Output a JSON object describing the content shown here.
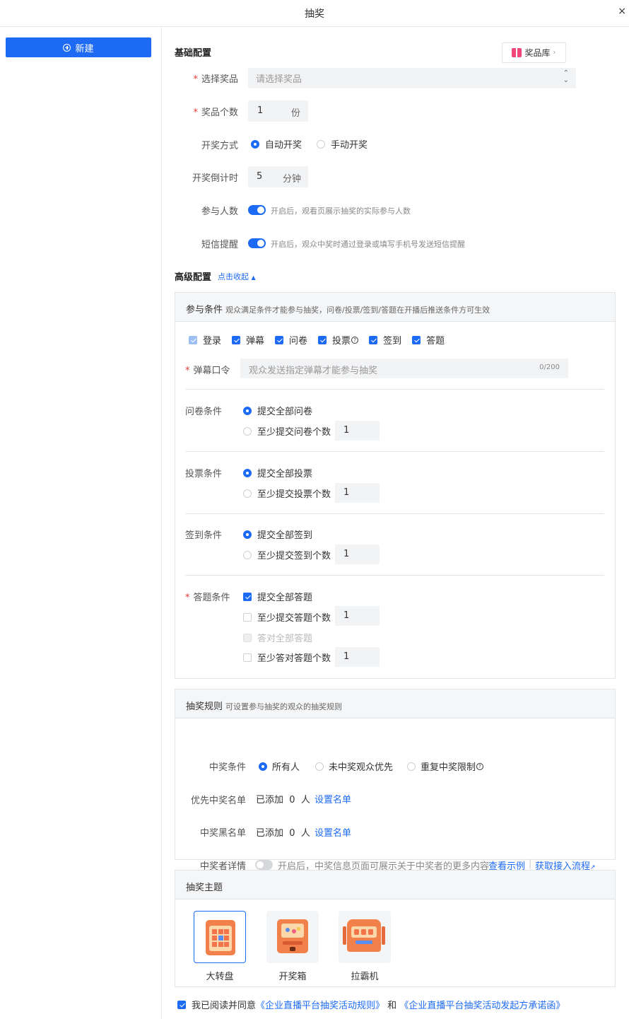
{
  "header": {
    "title": "抽奖",
    "close_icon": "×"
  },
  "sidebar": {
    "new_button": "新建"
  },
  "basic": {
    "title": "基础配置",
    "prize_lib": "奖品库",
    "prize_label": "选择奖品",
    "prize_placeholder": "请选择奖品",
    "count_label": "奖品个数",
    "count_value": "1",
    "count_unit": "份",
    "mode_label": "开奖方式",
    "mode_auto": "自动开奖",
    "mode_manual": "手动开奖",
    "countdown_label": "开奖倒计时",
    "countdown_value": "5",
    "countdown_unit": "分钟",
    "participants_label": "参与人数",
    "participants_hint": "开启后，观看页展示抽奖的实际参与人数",
    "sms_label": "短信提醒",
    "sms_hint": "开启后，观众中奖时通过登录或填写手机号发送短信提醒"
  },
  "advanced": {
    "title": "高级配置",
    "collapse": "点击收起"
  },
  "conditions": {
    "title": "参与条件",
    "desc": "观众满足条件才能参与抽奖，问卷/投票/签到/答题在开播后推送条件方可生效",
    "checks": [
      "登录",
      "弹幕",
      "问卷",
      "投票",
      "签到",
      "答题"
    ],
    "danmu_label": "弹幕口令",
    "danmu_placeholder": "观众发送指定弹幕才能参与抽奖",
    "danmu_counter": "0/200",
    "survey_label": "问卷条件",
    "survey_all": "提交全部问卷",
    "survey_min": "至少提交问卷个数",
    "survey_value": "1",
    "vote_label": "投票条件",
    "vote_all": "提交全部投票",
    "vote_min": "至少提交投票个数",
    "vote_value": "1",
    "signin_label": "签到条件",
    "signin_all": "提交全部签到",
    "signin_min": "至少提交签到个数",
    "signin_value": "1",
    "quiz_label": "答题条件",
    "quiz_all": "提交全部答题",
    "quiz_min": "至少提交答题个数",
    "quiz_min_value": "1",
    "quiz_correct_all": "答对全部答题",
    "quiz_correct_min": "至少答对答题个数",
    "quiz_correct_value": "1"
  },
  "rules": {
    "title": "抽奖规则",
    "desc": "可设置参与抽奖的观众的抽奖规则",
    "win_label": "中奖条件",
    "win_all": "所有人",
    "win_new": "未中奖观众优先",
    "win_repeat": "重复中奖限制",
    "priority_label": "优先中奖名单",
    "priority_added": "已添加",
    "priority_count": "0",
    "priority_unit": "人",
    "priority_link": "设置名单",
    "black_label": "中奖黑名单",
    "black_added": "已添加",
    "black_count": "0",
    "black_unit": "人",
    "black_link": "设置名单",
    "detail_label": "中奖者详情",
    "detail_hint": "开启后，中奖信息页面可展示关于中奖者的更多内容",
    "detail_example": "查看示例",
    "detail_flow": "获取接入流程"
  },
  "theme": {
    "title": "抽奖主题",
    "items": [
      "大转盘",
      "开奖箱",
      "拉霸机"
    ]
  },
  "agreement": {
    "text": "我已阅读并同意",
    "link1": "《企业直播平台抽奖活动规则》",
    "and": "和",
    "link2": "《企业直播平台抽奖活动发起方承诺函》"
  },
  "colors": {
    "accent": "#1d6bf5",
    "required": "#e53935"
  }
}
